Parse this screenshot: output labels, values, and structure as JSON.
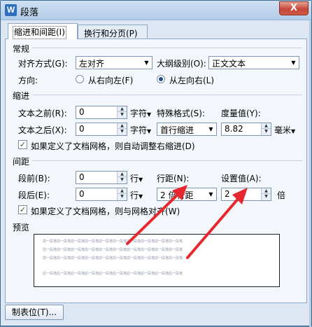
{
  "window": {
    "title": "段落",
    "app_icon": "W",
    "close_glyph": "X"
  },
  "tabs": [
    {
      "label": "缩进和间距(I)",
      "active": true
    },
    {
      "label": "换行和分页(P)",
      "active": false
    }
  ],
  "general": {
    "section_label": "常规",
    "alignment_label": "对齐方式(G):",
    "alignment_value": "左对齐",
    "outline_label": "大纲级别(O):",
    "outline_value": "正文文本",
    "direction_label": "方向:",
    "rtl_label": "从右向左(F)",
    "ltr_label": "从左向右(L)",
    "direction_selected": "ltr"
  },
  "indent": {
    "section_label": "缩进",
    "before_label": "文本之前(R):",
    "before_value": "0",
    "before_unit": "字符",
    "after_label": "文本之后(X):",
    "after_value": "0",
    "after_unit": "字符",
    "special_label": "特殊格式(S):",
    "special_value": "首行缩进",
    "measure_label": "度量值(Y):",
    "measure_value": "8.82",
    "measure_unit": "毫米",
    "grid_checkbox_label": "如果定义了文档网格，则自动调整右缩进(D)",
    "grid_checked": true
  },
  "spacing": {
    "section_label": "间距",
    "before_label": "段前(B):",
    "before_value": "0",
    "before_unit": "行",
    "after_label": "段后(E):",
    "after_value": "0",
    "after_unit": "行",
    "line_spacing_label": "行距(N):",
    "line_spacing_value": "2 倍行距",
    "set_value_label": "设置值(A):",
    "set_value": "2",
    "set_value_unit": "倍",
    "grid_checkbox_label": "如果定义了文档网格，则与网格对齐(W)",
    "grid_checked": true
  },
  "preview": {
    "section_label": "预览",
    "line_text": "前一段落前一段落前一段落前一段落前一段落前一段落前一段落前一段落前一段落前一段落",
    "sample_text": "前一段落前一段落前一段落前一段落前一段落前一段落前一段落前一段落前一段落前一段落",
    "after_text": "后一段落后一段落后一段落后一段落后一段落后一段落后一段落后一段落后一段落后一段落"
  },
  "footer": {
    "tabs_button_label": "制表位(T)..."
  },
  "annotation": {
    "arrow_color": "#e8262e"
  },
  "colors": {
    "accent": "#2d6fbd",
    "close": "#c7463a"
  }
}
